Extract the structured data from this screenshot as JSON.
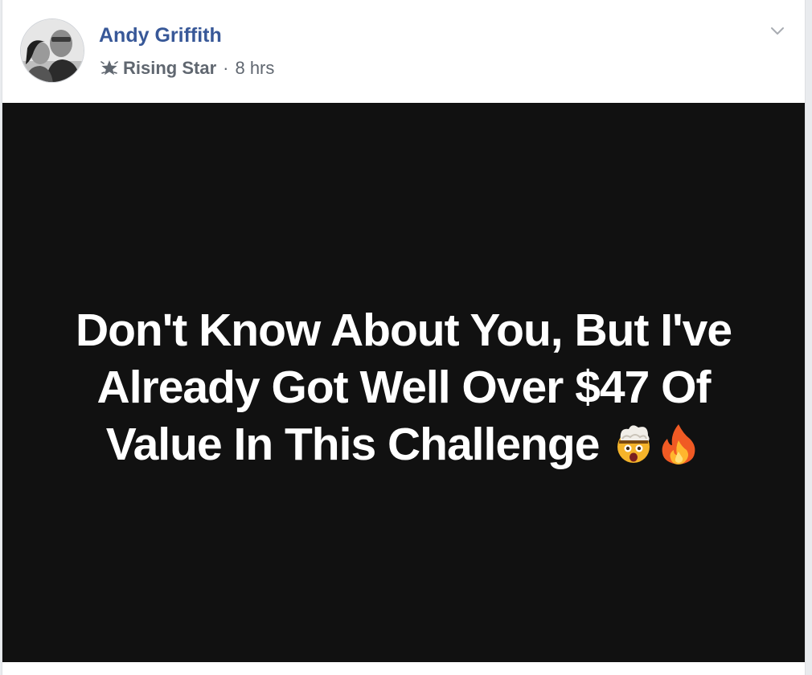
{
  "post": {
    "author": "Andy Griffith",
    "badge_label": "Rising Star",
    "separator": "·",
    "timestamp": "8 hrs",
    "badge_icon": "rising-star-badge-icon",
    "options_icon": "chevron-down-icon",
    "media_text_line1": "Don't Know About You, But I've",
    "media_text_line2": "Already Got Well Over $47 Of",
    "media_text_line3": "Value In This Challenge",
    "emojis": [
      "exploding-head-emoji",
      "fire-emoji"
    ]
  },
  "colors": {
    "author": "#385898",
    "meta": "#606770",
    "media_background": "#111111",
    "media_text": "#ffffff"
  }
}
